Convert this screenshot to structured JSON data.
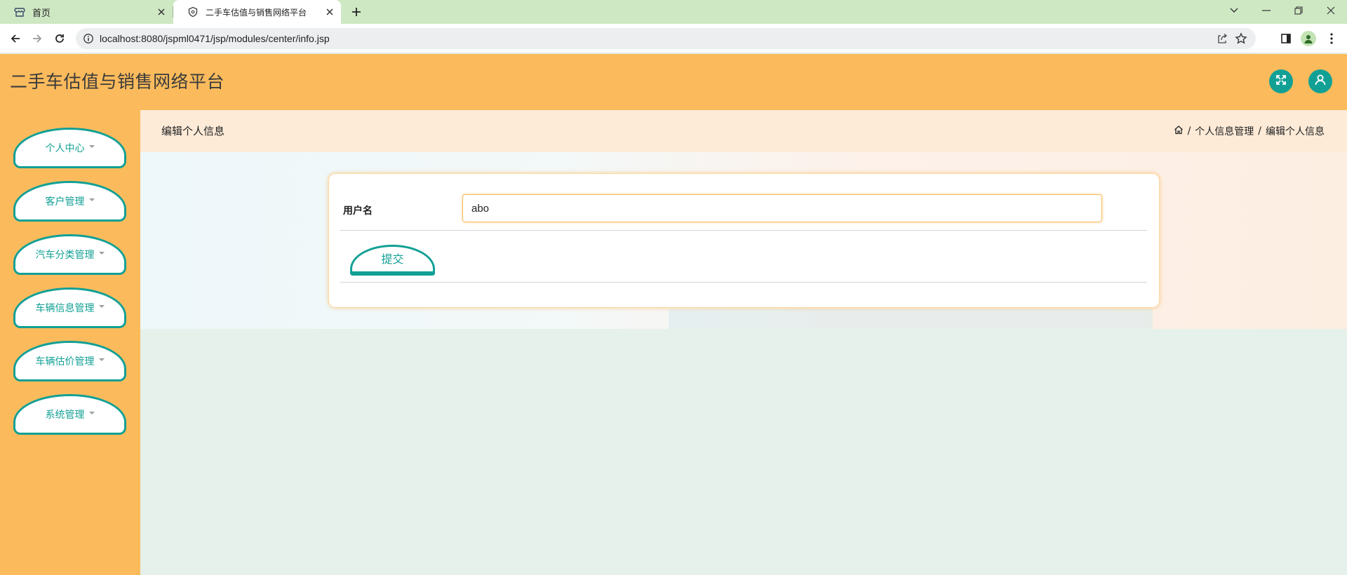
{
  "browser": {
    "tabs": [
      {
        "title": "首页",
        "active": false,
        "icon": "store-icon"
      },
      {
        "title": "二手车估值与销售网络平台",
        "active": true,
        "icon": "shield-icon"
      }
    ],
    "url": "localhost:8080/jspml0471/jsp/modules/center/info.jsp"
  },
  "app": {
    "title": "二手车估值与销售网络平台"
  },
  "sidebar": {
    "items": [
      {
        "label": "个人中心"
      },
      {
        "label": "客户管理"
      },
      {
        "label": "汽车分类管理"
      },
      {
        "label": "车辆信息管理"
      },
      {
        "label": "车辆估价管理"
      },
      {
        "label": "系统管理"
      }
    ]
  },
  "page": {
    "title": "编辑个人信息",
    "breadcrumb": [
      "个人信息管理",
      "编辑个人信息"
    ]
  },
  "form": {
    "username_label": "用户名",
    "username_value": "abo",
    "submit_label": "提交"
  },
  "colors": {
    "accent": "#12a095",
    "header_bg": "#fbbb5c",
    "page_bg": "#e5f1ea"
  }
}
